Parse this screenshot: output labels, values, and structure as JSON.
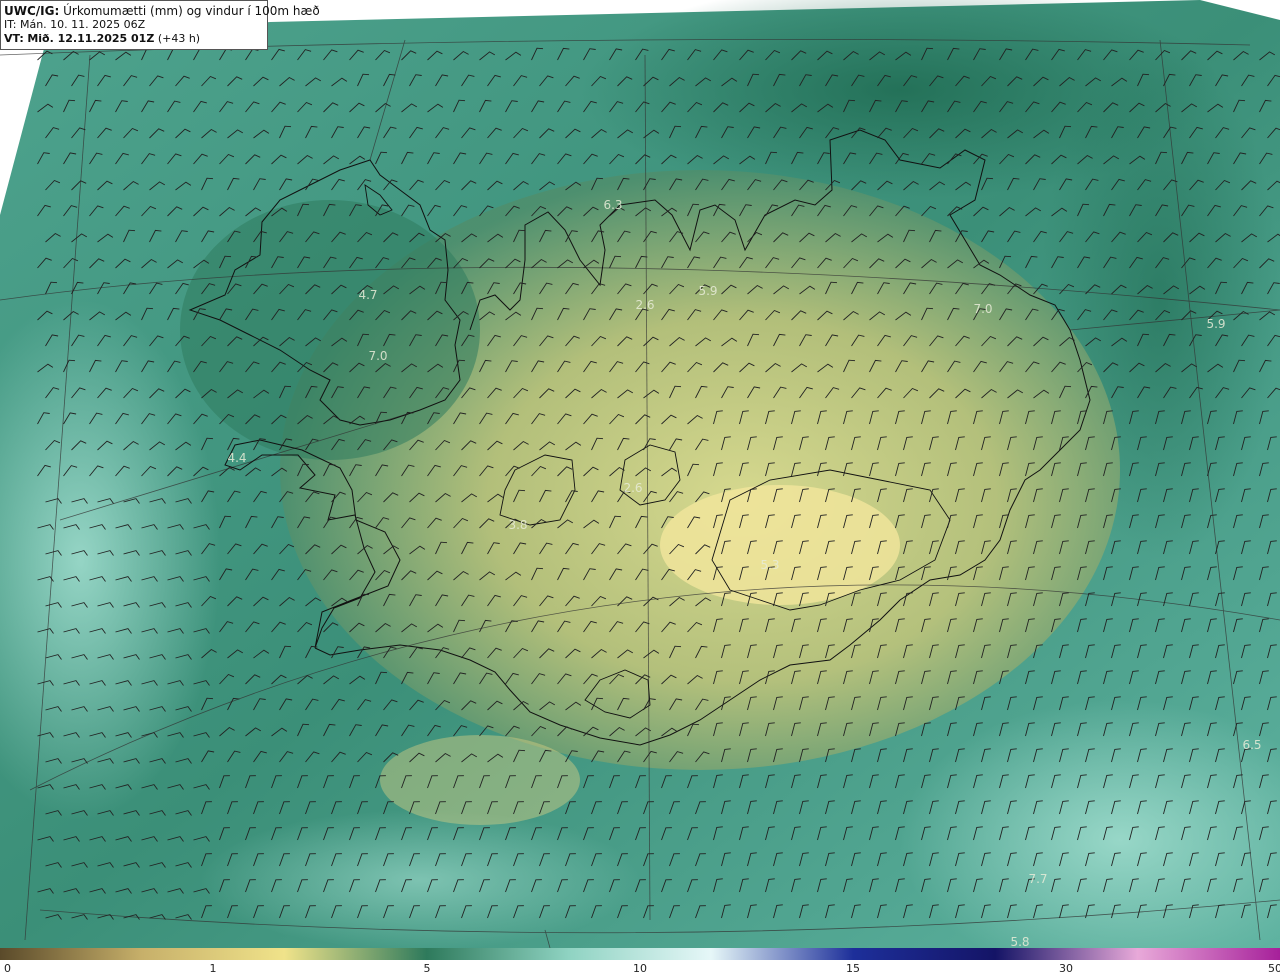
{
  "header": {
    "model_prefix": "UWC/IG:",
    "title": "Úrkomumætti (mm) og vindur í 100m hæð",
    "it_line": "IT: Mán. 10. 11. 2025 06Z",
    "vt_prefix": "VT:",
    "vt_bold": "Mið. 12.11.2025 01Z",
    "vt_suffix": "(+43 h)"
  },
  "map_values": [
    "6.3",
    "5.9",
    "2.6",
    "4.7",
    "7.0",
    "4.4",
    "7.0",
    "5.9",
    "6.5",
    "7.7",
    "5.8",
    "3.8",
    "2.6",
    "5.3"
  ],
  "colorbar": {
    "ticks": [
      "0",
      "1",
      "5",
      "10",
      "15",
      "30",
      "50"
    ],
    "colors": [
      "#5a4a2a",
      "#c7b06a",
      "#f0e38a",
      "#2e7a5c",
      "#8fd3c2",
      "#e6f7f8",
      "#1d2f9a",
      "#141466",
      "#e8a9d9",
      "#a6209a"
    ]
  },
  "colors": {
    "ocean_base": "#3f9a86",
    "ocean_light": "#8ccfc4",
    "land_low": "#e2d58a",
    "land_high": "#6b8f66",
    "coast": "#111111",
    "grid": "#333333",
    "barb": "#222222"
  }
}
